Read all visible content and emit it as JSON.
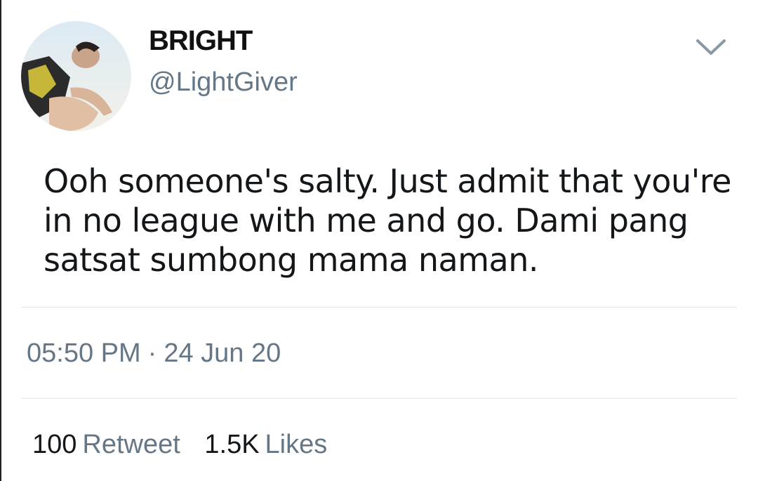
{
  "user": {
    "display_name": "BRIGHT",
    "handle": "@LightGiver"
  },
  "tweet": {
    "text": "Ooh someone's salty. Just admit that you're\nin no league with me and go. Dami pang\nsatsat sumbong mama naman.",
    "time": "05:50 PM",
    "separator": "·",
    "date": "24 Jun 20"
  },
  "stats": {
    "retweets_count": "100",
    "retweets_label": "Retweet",
    "likes_count": "1.5K",
    "likes_label": "Likes"
  },
  "icons": {
    "caret": "chevron-down-icon",
    "avatar": "avatar"
  },
  "colors": {
    "text": "#14171a",
    "secondary": "#657786",
    "divider": "#e1e8ed"
  }
}
